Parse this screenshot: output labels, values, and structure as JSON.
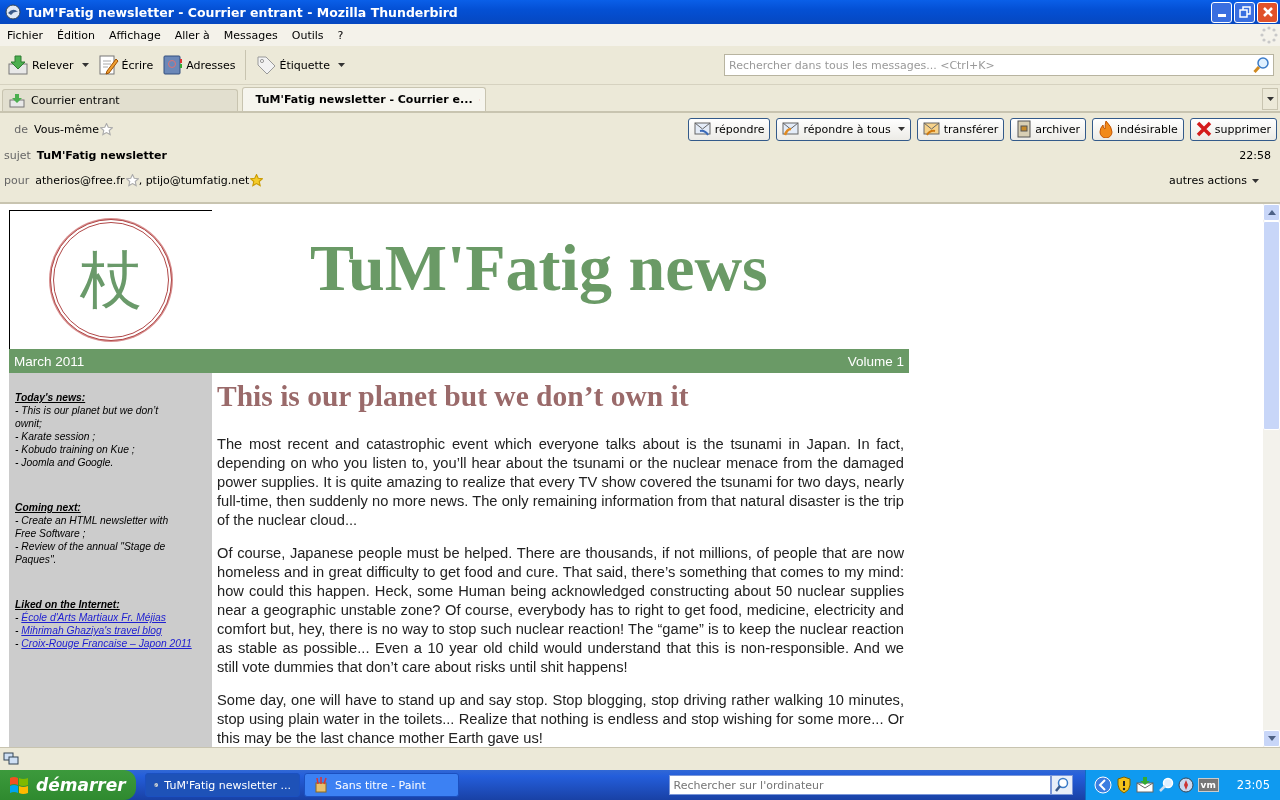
{
  "window": {
    "title": "TuM'Fatig newsletter - Courrier entrant - Mozilla Thunderbird"
  },
  "menu": [
    "Fichier",
    "Édition",
    "Affichage",
    "Aller à",
    "Messages",
    "Outils",
    "?"
  ],
  "toolbar": [
    {
      "kind": "get",
      "label": "Relever",
      "dropdown": true
    },
    {
      "kind": "write",
      "label": "Écrire",
      "dropdown": false
    },
    {
      "kind": "book",
      "label": "Adresses",
      "dropdown": false
    },
    {
      "kind": "tag",
      "label": "Étiquette",
      "dropdown": true
    }
  ],
  "search": {
    "placeholder": "Rechercher dans tous les messages... <Ctrl+K>"
  },
  "tabs": [
    {
      "kind": "folder",
      "label": "Courrier entrant",
      "selected": false
    },
    {
      "kind": "message",
      "label": "TuM'Fatig newsletter - Courrier e...",
      "selected": true
    }
  ],
  "header": {
    "from_label": "de",
    "from": [
      {
        "name": "Vous-même",
        "starred": false
      }
    ],
    "subject_label": "sujet",
    "subject": "TuM'Fatig newsletter",
    "time": "22:58",
    "to_label": "pour",
    "to": [
      {
        "name": "atherios@free.fr",
        "starred": false
      },
      {
        "name": "ptijo@tumfatig.net",
        "starred": true
      }
    ],
    "to_separator": ", ",
    "actions": [
      {
        "kind": "reply",
        "label": "répondre",
        "dropdown": false
      },
      {
        "kind": "replyall",
        "label": "répondre à tous",
        "dropdown": true
      },
      {
        "kind": "forward",
        "label": "transférer",
        "dropdown": false
      },
      {
        "kind": "archive",
        "label": "archiver",
        "dropdown": false
      },
      {
        "kind": "junk",
        "label": "indésirable",
        "dropdown": false
      },
      {
        "kind": "delete",
        "label": "supprimer",
        "dropdown": false
      }
    ],
    "more": "autres actions"
  },
  "newsletter": {
    "logo_char": "杖",
    "title": "TuM'Fatig news",
    "date": "March 2011",
    "volume": "Volume 1",
    "sidebar": [
      {
        "heading": "Today's news:",
        "items": [
          {
            "kind": "text",
            "bullet": "-",
            "text": "This is our planet but we don’t ownit;"
          },
          {
            "kind": "text",
            "bullet": "-",
            "text": "Karate session ;"
          },
          {
            "kind": "text",
            "bullet": "-",
            "text": "Kobudo training on Kue ;"
          },
          {
            "kind": "text",
            "bullet": "-",
            "text": "Joomla and Google."
          }
        ]
      },
      {
        "heading": "Coming next:",
        "items": [
          {
            "kind": "text",
            "bullet": "-",
            "text": "Create an HTML newsletter with Free Software ;"
          },
          {
            "kind": "text",
            "bullet": "-",
            "text": "Review of the annual \"Stage de Paques\"."
          }
        ]
      },
      {
        "heading": "Liked on the Internet:",
        "items": [
          {
            "kind": "link",
            "bullet": "-",
            "text": "École d'Arts Martiaux Fr. Méjias"
          },
          {
            "kind": "link",
            "bullet": "-",
            "text": "Mihrimah Ghaziya's travel blog"
          },
          {
            "kind": "link",
            "bullet": "-",
            "text": "Croix-Rouge Francaise – Japon 2011"
          }
        ]
      }
    ],
    "heading": "This is our planet but we don’t own it",
    "paragraphs": [
      "The most recent and catastrophic event which everyone talks about is the tsunami in Japan. In fact, depending on who you listen to, you’ll hear about the tsunami or the nuclear menace from the damaged power supplies. It is quite amazing to realize that every TV show covered the tsunami for two days, nearly full-time, then suddenly no more news. The only remaining information from that natural disaster is the trip of the nuclear cloud...",
      "Of course, Japanese people must be helped. There are thousands, if not millions, of people that are now homeless and in great difficulty to get food and cure. That said, there’s something that comes to my mind: how could this happen. Heck, some Human being acknowledged constructing about 50 nuclear supplies near a geographic unstable zone? Of course, everybody has to right to get food, medicine, electricity and comfort but, hey, there is no way to stop such nuclear reaction! The “game” is to keep the nuclear reaction as stable as possible... Even a 10 year old child would understand that this is non-responsible. And we still vote dummies that don’t care about risks until shit happens!",
      "Some day, one will have to stand up and say stop. Stop blogging, stop driving rather walking 10 minutes, stop using plain water in the toilets... Realize that nothing is endless and stop wishing for some more... Or this may be the last chance mother Earth gave us!"
    ]
  },
  "taskbar": {
    "start": "démarrer",
    "tasks": [
      {
        "kind": "thunderbird",
        "label": "TuM'Fatig newsletter ...",
        "selected": true
      },
      {
        "kind": "paint",
        "label": "Sans titre - Paint",
        "selected": false
      }
    ],
    "search": {
      "placeholder": "Rechercher sur l'ordinateur"
    },
    "tray_vm": "vm",
    "clock": "23:05"
  }
}
